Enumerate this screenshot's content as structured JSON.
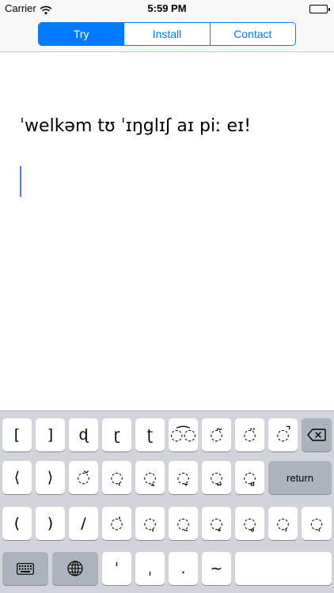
{
  "status_bar": {
    "carrier": "Carrier",
    "time": "5:59 PM",
    "icons": [
      "wifi-icon",
      "battery-icon"
    ]
  },
  "nav": {
    "segments": [
      {
        "label": "Try",
        "selected": true
      },
      {
        "label": "Install",
        "selected": false
      },
      {
        "label": "Contact",
        "selected": false
      }
    ],
    "accent_color": "#007aff"
  },
  "content": {
    "ipa_text": "ˈwelkəm tʊ ˈɪŋglɪʃ aɪ piː eɪ!",
    "cursor_color": "#4a78ff"
  },
  "keyboard": {
    "row1": [
      "[",
      "]",
      "ɖ",
      "ɽ",
      "ʈ",
      "◌͡◌",
      "◌̃",
      "◌̈",
      "◌̚"
    ],
    "row1_action": "backspace-icon",
    "row2": [
      "⟨",
      "⟩",
      "◌̆",
      "◌̜",
      "◌̝",
      "◌̞",
      "◌̺",
      "◌̻"
    ],
    "row2_action": "return",
    "row3": [
      "(",
      ")",
      "/",
      "◌̇",
      "◌̩",
      "◌̠",
      "◌̟",
      "◌̥",
      "◌̹",
      "◌̜"
    ],
    "row4": {
      "keyboard_icon": "keyboard-icon",
      "globe_icon": "globe-icon",
      "keys": [
        "ˈ",
        "ˌ",
        ".",
        "~"
      ]
    }
  }
}
